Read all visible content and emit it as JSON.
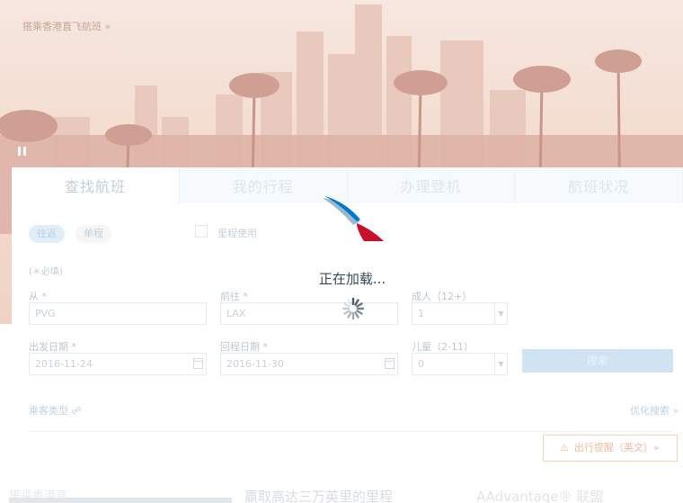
{
  "hero": {
    "promo_link": "搭乘香港直飞航班 »"
  },
  "tabs": [
    {
      "label": "查找航班"
    },
    {
      "label": "我的行程"
    },
    {
      "label": "办理登机"
    },
    {
      "label": "航班状况"
    }
  ],
  "trip_type": {
    "round_trip": "往返",
    "one_way": "单程"
  },
  "miles": {
    "label": "里程使用"
  },
  "required_note": "(＊必填)",
  "from": {
    "label": "从 *",
    "value": "PVG"
  },
  "to": {
    "label": "前往 *",
    "value": "LAX"
  },
  "adults": {
    "label": "成人（12+）",
    "value": "1"
  },
  "depart": {
    "label": "出发日期 *",
    "value": "2016-11-24"
  },
  "return": {
    "label": "回程日期 *",
    "value": "2016-11-30"
  },
  "children": {
    "label": "儿童（2-11）",
    "value": "0"
  },
  "search_button": "搜索",
  "passenger_type_link": "乘客类型 ☍",
  "advanced_search_link": "优化搜索 »",
  "travel_alert": {
    "icon": "warning-icon",
    "label": "出行提醒（英文）»"
  },
  "loading": {
    "text": "正在加载..."
  },
  "bottom": {
    "left_heading": "搭乘香港直",
    "center_heading": "赢取高达三万英里的里程",
    "right_heading": "AAdvantage® 联盟"
  },
  "colors": {
    "brand_red": "#c8102e",
    "brand_blue": "#0078d2",
    "text_dark": "#36495a"
  }
}
